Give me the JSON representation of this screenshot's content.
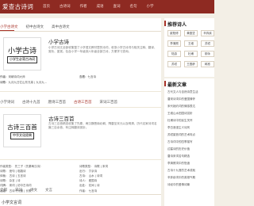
{
  "header": {
    "logo": "爱查古诗词",
    "nav": [
      "首页",
      "古诗词",
      "作者",
      "成语",
      "查词",
      "名句",
      "小学"
    ]
  },
  "main": {
    "tabs": [
      "小学古诗文",
      "初中古诗文",
      "高中古诗文"
    ],
    "book1": {
      "cover_big": "小学古诗",
      "cover_sub": "小学生必背古诗词",
      "title": "小学古诗",
      "desc": "小学古诗文全部收集整了小学语文教材里的诗词，收录小学古诗词与相关注释、翻译、赏析、鉴赏。包含小学一年级到六年级全部古诗，方便学习查询。",
      "meta1_k": "作者：",
      "meta1_v": "宋朝诗词大师",
      "meta1b_k": "查看：",
      "meta1b_v": "七言诗",
      "meta2_k": "诗歌：",
      "meta2_v": "九月九日忆山东兄弟 | 九月九..."
    },
    "tabs2": [
      "小学诗词",
      "古诗十九首",
      "唐诗三百首",
      "古诗三百首",
      "宋词三百首"
    ],
    "book2": {
      "cover_big": "古诗三百首",
      "cover_sub": "中华文化经典",
      "title": "古诗三百首",
      "desc": "古诗三百首精选收集了先秦，两汉魏晋南北朝，隋唐至宋元以及明清，历代名家诗词名篇三百余首，有注释翻译赏析。"
    },
    "grid2": [
      [
        "作者类型：  先三子（先秦两汉诗）",
        "诗歌类型：  诗歌 | 宋词"
      ],
      [
        "诗歌：  绝句 | 临路诗",
        "出行：  汴京诗"
      ],
      [
        "体裁：  古诗 | 五言诗",
        "古诗：  山水 | 诗词"
      ],
      [
        "诗歌：  杂言 | 诗",
        "诗人：  爱国诗"
      ],
      [
        "词牌：  宋词 | 初中古诗词",
        "出处：  花间 | 诗"
      ],
      [
        "出处：  古诗十九首 | 长歌",
        "作者：  七言诗"
      ]
    ],
    "bottom_tabs": [
      "全部",
      "宋词",
      "诗文",
      "文言"
    ],
    "bottom_title": "小学文言词"
  },
  "sidebar": {
    "title": "推荐诗人",
    "tags": [
      "欧阳修",
      "黄庭坚",
      "辛弃疾",
      "李清照",
      "王维",
      "苏轼",
      "陆游",
      "杜甫",
      "柳永",
      "苏轼",
      "王昌龄",
      "韩愈"
    ],
    "articles_title": "最新文章",
    "articles": [
      "古代文人与自然诗意生活",
      "唐宋诗词中的爱国情怀",
      "宋代婉约词的情感表达",
      "王维山水田园诗赏析",
      "杜甫诗中的民生关怀",
      "李白浪漫主义诗风",
      "苏轼豪放词的艺术特点",
      "古诗词中的四季描写",
      "边塞诗的历史价值",
      "唐诗宋词名句精选",
      "李清照词中的愁绪",
      "古诗十九首的艺术成就",
      "辛弃疾词中的英雄气概",
      "诗经中的爱情诗篇"
    ]
  }
}
